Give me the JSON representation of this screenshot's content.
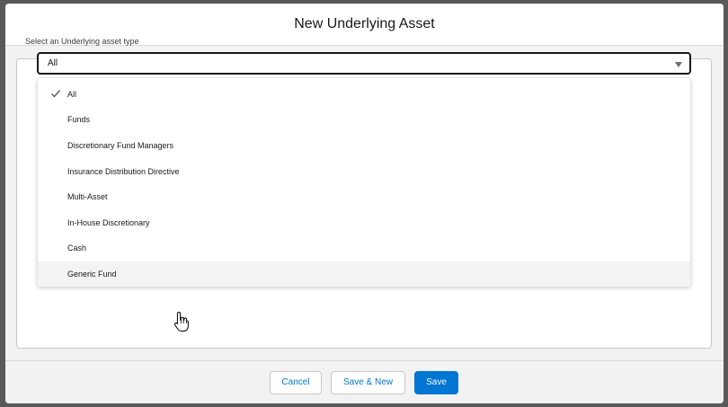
{
  "modal": {
    "title": "New Underlying Asset"
  },
  "field": {
    "label": "Select an Underlying asset type",
    "selected_value": "All"
  },
  "dropdown": {
    "options": [
      {
        "label": "All",
        "selected": true
      },
      {
        "label": "Funds",
        "selected": false
      },
      {
        "label": "Discretionary Fund Managers",
        "selected": false
      },
      {
        "label": "Insurance Distribution Directive",
        "selected": false
      },
      {
        "label": "Multi-Asset",
        "selected": false
      },
      {
        "label": "In-House Discretionary",
        "selected": false
      },
      {
        "label": "Cash",
        "selected": false
      },
      {
        "label": "Generic Fund",
        "selected": false,
        "hovered": true
      }
    ]
  },
  "footer": {
    "cancel_label": "Cancel",
    "save_new_label": "Save & New",
    "save_label": "Save"
  },
  "icons": {
    "check": "check-icon",
    "caret": "chevron-down-icon",
    "cursor": "hand-pointer-icon"
  },
  "colors": {
    "brand": "#0176d3",
    "backdrop": "#595959",
    "hover_row": "#f3f3f3"
  }
}
